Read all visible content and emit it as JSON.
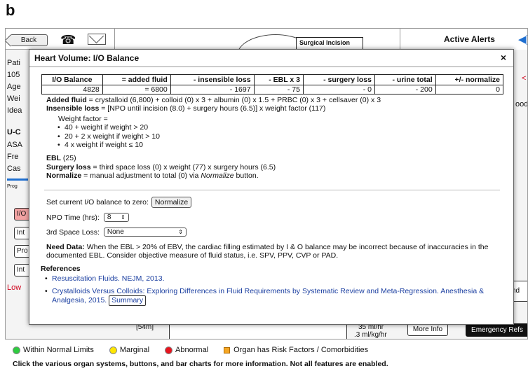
{
  "figure_label": "b",
  "topbar": {
    "back_label": "Back",
    "surgical_label": "Surgical Incision",
    "alerts_title": "Active Alerts"
  },
  "background": {
    "left_labels": [
      "Pati",
      "105",
      "Age",
      "Wei",
      "Idea"
    ],
    "section_u": "U-C",
    "section_rows": [
      "ASA",
      "Fre",
      "Cas"
    ],
    "prog": "Prog",
    "side_buttons": [
      "I/O",
      "Int",
      "Pro",
      "Int"
    ],
    "low_label": "Low",
    "right_red": "<",
    "right_text": "ood",
    "ond_text": "nd",
    "bottom_bracket": "[54m]",
    "rate_line1": "35 ml/hr",
    "rate_line2": ".3 ml/kg/hr",
    "more_info": "More Info",
    "emergency_refs": "Emergency Refs"
  },
  "dialog": {
    "title": "Heart Volume: I/O Balance",
    "close": "×",
    "table": {
      "headers": [
        "I/O Balance",
        "= added fluid",
        "- insensible loss",
        "- EBL x 3",
        "- surgery loss",
        "- urine total",
        "+/- normalize"
      ],
      "values": [
        "4828",
        "= 6800",
        "- 1697",
        "- 75",
        "- 0",
        "- 200",
        "0"
      ]
    },
    "added_fluid_label": "Added fluid",
    "added_fluid_text": " = crystalloid (6,800) + colloid (0) x 3 + albumin (0) x 1.5 + PRBC (0) x 3 + cellsaver (0) x 3",
    "insensible_label": "Insensible loss",
    "insensible_text": " = [NPO until incision (8.0) + surgery hours (6.5)] x weight factor (117)",
    "weight_factor_title": "Weight factor =",
    "weight_factor_items": [
      "40 + weight if weight > 20",
      "20 + 2 x weight if weight > 10",
      "4 x weight if weight ≤ 10"
    ],
    "ebl_label": "EBL",
    "ebl_text": " (25)",
    "surgery_loss_label": "Surgery loss",
    "surgery_loss_text": " = third space loss (0) x weight (77) x surgery hours (6.5)",
    "normalize_label": "Normalize",
    "normalize_text_a": " = manual adjustment to total (0) via ",
    "normalize_text_em": "Normalize",
    "normalize_text_b": " button.",
    "set_zero_label": "Set current I/O balance to zero:",
    "normalize_button": "Normalize",
    "npo_label": "NPO Time (hrs):",
    "npo_value": "8",
    "third_space_label": "3rd Space Loss:",
    "third_space_value": "None",
    "need_data_label": "Need Data:",
    "need_data_text": " When the EBL > 20% of EBV, the cardiac filling estimated by I & O balance may be incorrect because of inaccuracies in the documented EBL. Consider objective measure of fluid status, i.e. SPV, PPV, CVP or PAD.",
    "references_title": "References",
    "ref1": "Resuscitation Fluids. NEJM, 2013.",
    "ref2": "Crystalloids Versus Colloids: Exploring Differences in Fluid Requirements by Systematic Review and Meta-Regression. Anesthesia & Analgesia, 2015.",
    "summary_button": "Summary"
  },
  "legend": {
    "items": [
      {
        "label": "Within Normal Limits",
        "color": "#2ecc40"
      },
      {
        "label": "Marginal",
        "color": "#ffe600"
      },
      {
        "label": "Abnormal",
        "color": "#e8141e"
      },
      {
        "label": "Organ has Risk Factors / Comorbidities",
        "color": "#f5a623"
      }
    ]
  },
  "footnote": "Click the various organ systems, buttons, and bar charts for more information. Not all features are enabled."
}
